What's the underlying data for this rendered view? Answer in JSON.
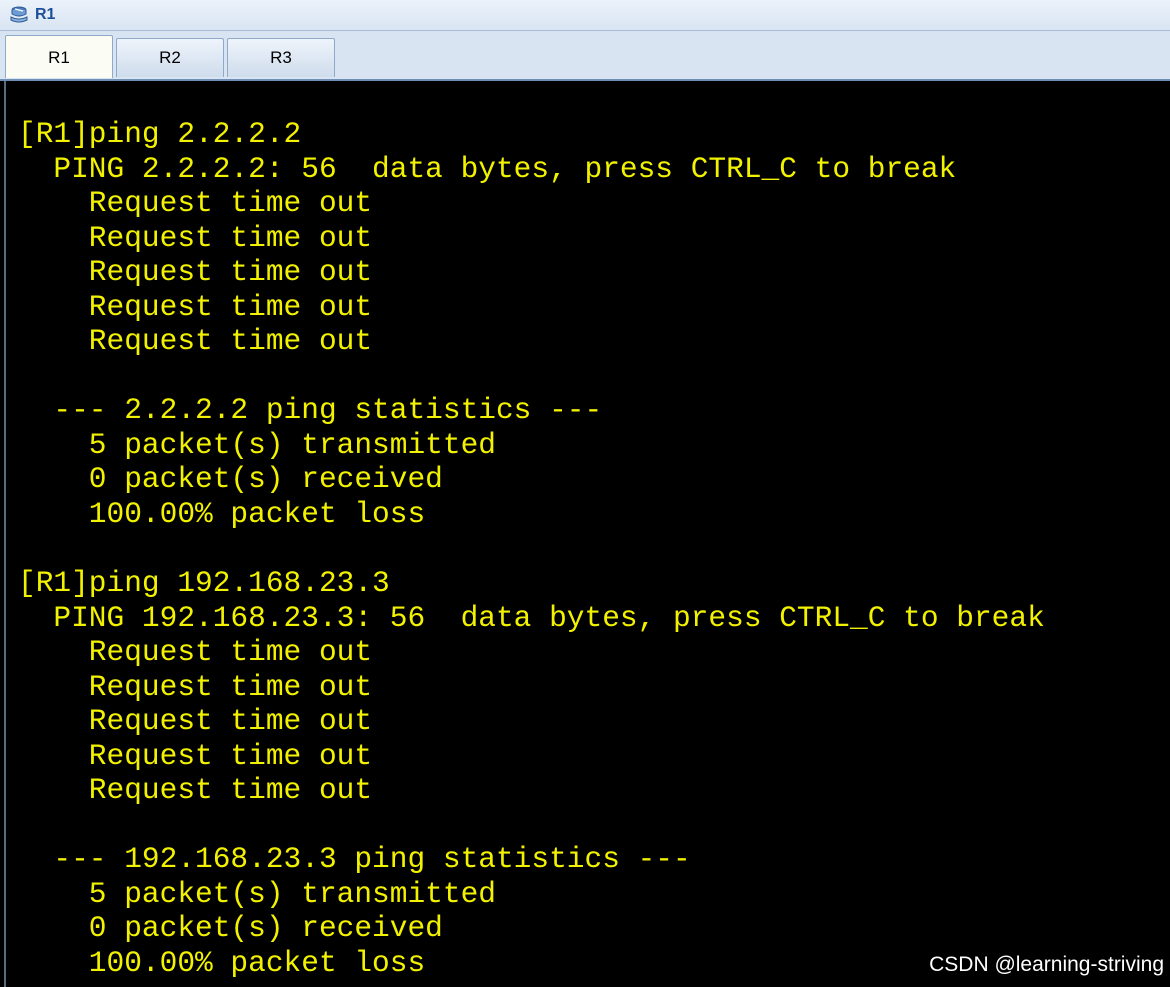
{
  "window": {
    "title": "R1",
    "icon": "router-console-icon"
  },
  "tabs": [
    {
      "label": "R1",
      "active": true
    },
    {
      "label": "R2",
      "active": false
    },
    {
      "label": "R3",
      "active": false
    }
  ],
  "terminal": {
    "text_color": "#f2f200",
    "background": "#000000",
    "lines": [
      "[R1]ping 2.2.2.2",
      "  PING 2.2.2.2: 56  data bytes, press CTRL_C to break",
      "    Request time out",
      "    Request time out",
      "    Request time out",
      "    Request time out",
      "    Request time out",
      "",
      "  --- 2.2.2.2 ping statistics ---",
      "    5 packet(s) transmitted",
      "    0 packet(s) received",
      "    100.00% packet loss",
      "",
      "[R1]ping 192.168.23.3",
      "  PING 192.168.23.3: 56  data bytes, press CTRL_C to break",
      "    Request time out",
      "    Request time out",
      "    Request time out",
      "    Request time out",
      "    Request time out",
      "",
      "  --- 192.168.23.3 ping statistics ---",
      "    5 packet(s) transmitted",
      "    0 packet(s) received",
      "    100.00% packet loss"
    ]
  },
  "watermark": "CSDN @learning-striving"
}
